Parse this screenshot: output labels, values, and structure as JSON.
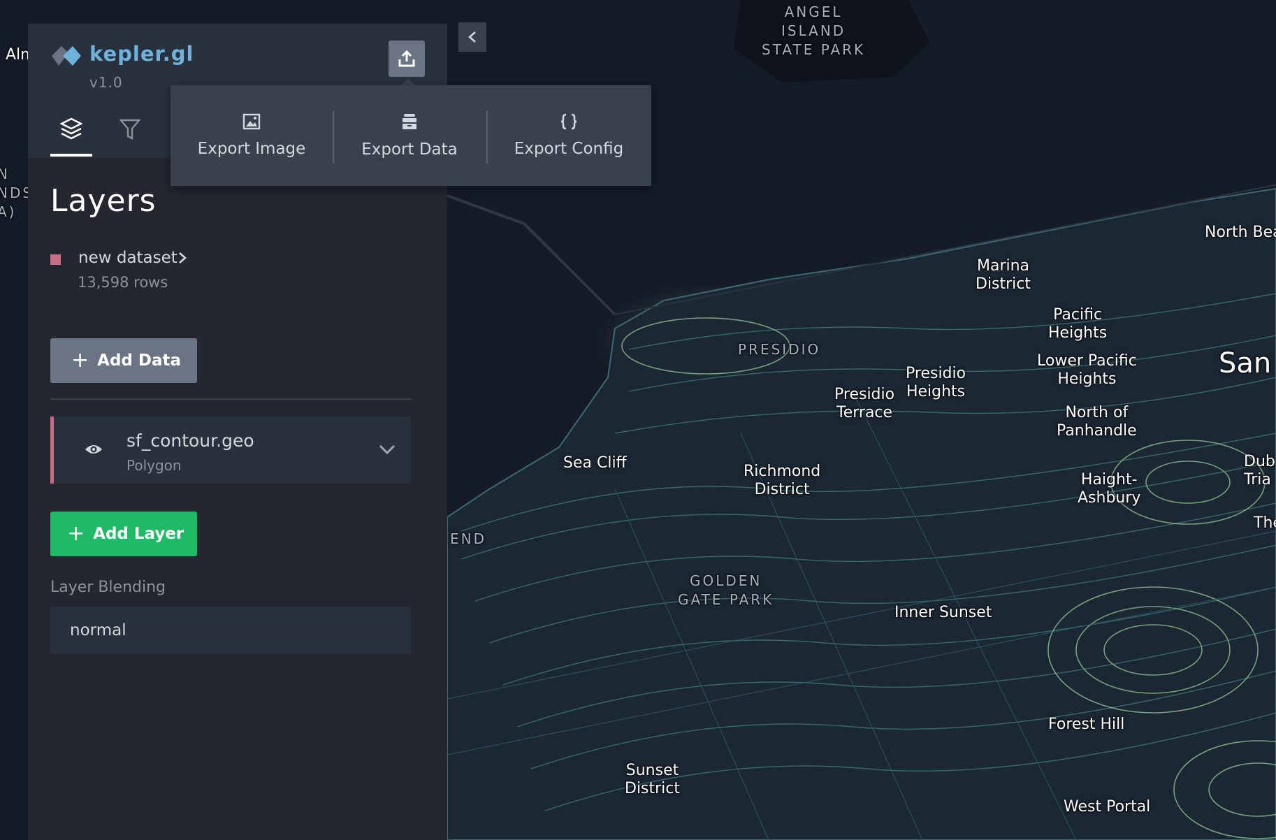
{
  "app": {
    "name": "kepler.gl",
    "version": "v1.0"
  },
  "tabs": [
    {
      "id": "layers",
      "icon": "layers-icon",
      "active": true
    },
    {
      "id": "filters",
      "icon": "filter-icon",
      "active": false
    }
  ],
  "export_menu": {
    "items": [
      {
        "label": "Export Image",
        "icon": "image-icon"
      },
      {
        "label": "Export Data",
        "icon": "database-icon"
      },
      {
        "label": "Export Config",
        "icon": "braces-icon"
      }
    ]
  },
  "layers_panel": {
    "title": "Layers",
    "dataset": {
      "name": "new dataset",
      "rows": "13,598 rows",
      "color": "#c76d86"
    },
    "add_data_label": "Add Data",
    "layer": {
      "name": "sf_contour.geo",
      "type": "Polygon",
      "color": "#c76d86"
    },
    "add_layer_label": "Add Layer",
    "blending": {
      "label": "Layer Blending",
      "value": "normal"
    }
  },
  "colors": {
    "panel_bg": "#242730",
    "header_bg": "#29323c",
    "accent_green": "#1fba66",
    "accent_blue": "#6fb3dd",
    "map_bg": "#151b27"
  },
  "map": {
    "labels": [
      {
        "id": "angel-island",
        "text": "ANGEL\nISLAND\nSTATE PARK",
        "kind": "park"
      },
      {
        "id": "alm",
        "text": "Alm",
        "kind": "place"
      },
      {
        "id": "nds",
        "text": "N\nNDS\nA)",
        "kind": "park"
      },
      {
        "id": "north-beach",
        "text": "North Bea",
        "kind": "place"
      },
      {
        "id": "marina",
        "text": "Marina\nDistrict",
        "kind": "place"
      },
      {
        "id": "pacific-heights",
        "text": "Pacific\nHeights",
        "kind": "place"
      },
      {
        "id": "presidio",
        "text": "PRESIDIO",
        "kind": "park"
      },
      {
        "id": "lower-pacific",
        "text": "Lower Pacific\nHeights",
        "kind": "place"
      },
      {
        "id": "san-francisco",
        "text": "San F",
        "kind": "city"
      },
      {
        "id": "presidio-heights",
        "text": "Presidio\nHeights",
        "kind": "place"
      },
      {
        "id": "presidio-terrace",
        "text": "Presidio\nTerrace",
        "kind": "place"
      },
      {
        "id": "north-panhandle",
        "text": "North of\nPanhandle",
        "kind": "place"
      },
      {
        "id": "sea-cliff",
        "text": "Sea Cliff",
        "kind": "place"
      },
      {
        "id": "richmond",
        "text": "Richmond\nDistrict",
        "kind": "place"
      },
      {
        "id": "haight",
        "text": "Haight-\nAshbury",
        "kind": "place"
      },
      {
        "id": "dub",
        "text": "Dub\nTria",
        "kind": "place"
      },
      {
        "id": "the",
        "text": "The",
        "kind": "place"
      },
      {
        "id": "end",
        "text": "END",
        "kind": "park"
      },
      {
        "id": "golden-gate",
        "text": "GOLDEN\nGATE PARK",
        "kind": "park"
      },
      {
        "id": "inner-sunset",
        "text": "Inner Sunset",
        "kind": "place"
      },
      {
        "id": "forest-hill",
        "text": "Forest Hill",
        "kind": "place"
      },
      {
        "id": "sunset",
        "text": "Sunset\nDistrict",
        "kind": "place"
      },
      {
        "id": "west-portal",
        "text": "West Portal",
        "kind": "place"
      }
    ]
  }
}
